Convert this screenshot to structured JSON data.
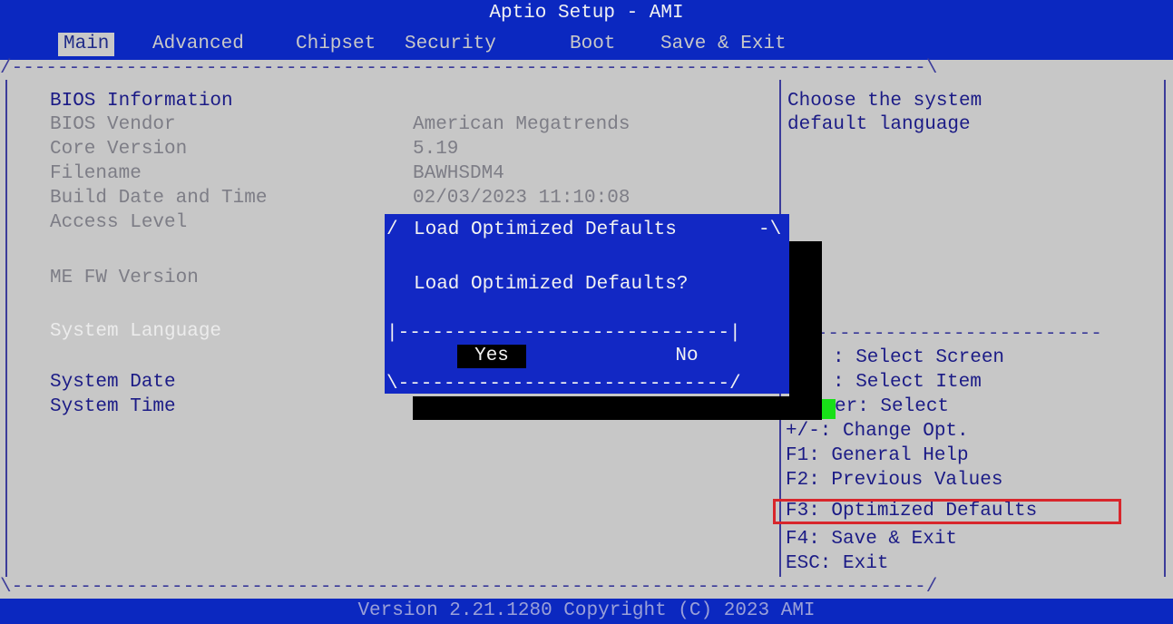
{
  "header": {
    "title": "Aptio Setup - AMI",
    "tabs": [
      {
        "label": "Main",
        "active": true
      },
      {
        "label": "Advanced"
      },
      {
        "label": "Chipset"
      },
      {
        "label": "Security"
      },
      {
        "label": "Boot"
      },
      {
        "label": "Save & Exit"
      }
    ]
  },
  "main": {
    "items": [
      {
        "label": "BIOS Information",
        "value": ""
      },
      {
        "label": "BIOS Vendor",
        "value": "American Megatrends"
      },
      {
        "label": "Core Version",
        "value": "5.19"
      },
      {
        "label": "Filename",
        "value": "BAWHSDM4"
      },
      {
        "label": "Build Date and Time",
        "value": "02/03/2023 11:10:08"
      },
      {
        "label": "Access Level",
        "value": ""
      },
      {
        "label": "ME FW Version",
        "value": ""
      },
      {
        "label": "System Language",
        "value": ""
      },
      {
        "label": "System Date",
        "value": ""
      },
      {
        "label": "System Time",
        "value": ""
      }
    ]
  },
  "help_panel": {
    "description": [
      "Choose the system",
      "default language"
    ],
    "keys": [
      ": Select Screen",
      ": Select Item",
      "er: Select",
      "+/-: Change Opt.",
      "F1: General Help",
      "F2: Previous Values",
      "F3: Optimized Defaults",
      "F4: Save & Exit",
      "ESC: Exit"
    ]
  },
  "dialog": {
    "title": "Load Optimized Defaults",
    "message": "Load Optimized Defaults?",
    "yes_label": "Yes",
    "no_label": "No"
  },
  "footer": {
    "version": "Version 2.21.1280 Copyright (C) 2023 AMI"
  },
  "colors": {
    "bar_blue": "#0b28c0",
    "screen_gray": "#c7c7c7",
    "text_blue": "#1b1b86",
    "highlight_red": "#d8262c"
  }
}
